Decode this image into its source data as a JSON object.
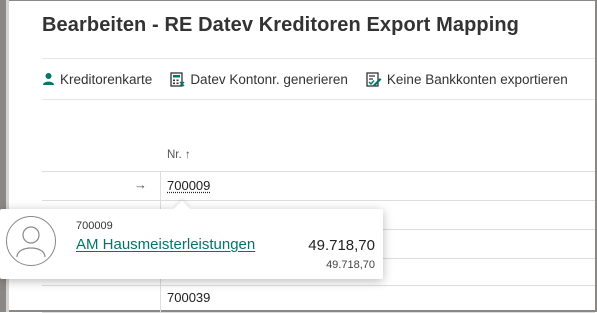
{
  "title": "Bearbeiten - RE Datev Kreditoren Export Mapping",
  "actions": [
    {
      "label": "Kreditorenkarte",
      "icon": "person-icon"
    },
    {
      "label": "Datev Kontonr. generieren",
      "icon": "calculator-icon"
    },
    {
      "label": "Keine Bankkonten exportieren",
      "icon": "edit-list-icon"
    }
  ],
  "table": {
    "column_header": "Nr. ↑",
    "selected_arrow": "→",
    "rows": [
      {
        "no": "700009",
        "active": true
      },
      {
        "no": ""
      },
      {
        "no": ""
      },
      {
        "no": ""
      },
      {
        "no": "700039"
      }
    ]
  },
  "popup": {
    "id": "700009",
    "name": "AM Hausmeisterleistungen",
    "amount": "49.718,70",
    "amount_secondary": "49.718,70"
  },
  "colors": {
    "accent": "#00766a",
    "icon": "#00766a"
  }
}
